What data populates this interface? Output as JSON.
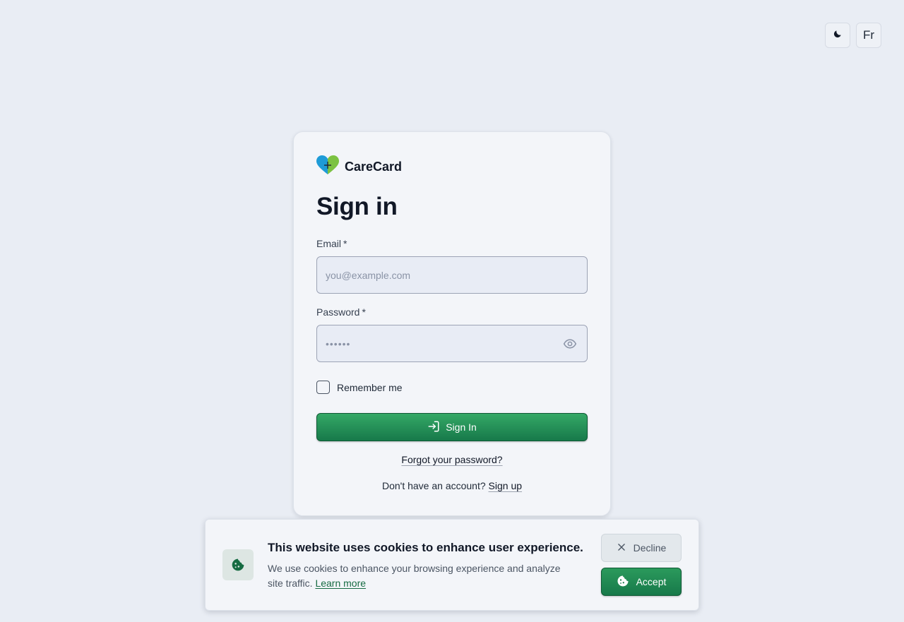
{
  "top_controls": {
    "theme_icon": "moon-icon",
    "language_label": "Fr"
  },
  "brand": {
    "name": "CareCard",
    "logo_icon": "heart-plus-icon",
    "logo_colors": [
      "#1e9bd7",
      "#7cc242"
    ]
  },
  "form": {
    "title": "Sign in",
    "email_label": "Email",
    "email_required_mark": "*",
    "email_placeholder": "you@example.com",
    "password_label": "Password",
    "password_required_mark": "*",
    "password_mask": "••••••",
    "password_toggle_icon": "eye-icon",
    "remember_label": "Remember me",
    "submit_label": "Sign In",
    "submit_icon": "sign-in-icon",
    "forgot_link": "Forgot your password?",
    "signup_prompt": "Don't have an account?",
    "signup_link": "Sign up"
  },
  "cookie_banner": {
    "icon": "cookie-icon",
    "title": "This website uses cookies to enhance user experience.",
    "text": "We use cookies to enhance your browsing experience and analyze site traffic.",
    "learn_more": "Learn more",
    "decline_label": "Decline",
    "decline_icon": "close-icon",
    "accept_label": "Accept",
    "accept_icon": "cookie-icon"
  },
  "colors": {
    "page_bg": "#e9edf4",
    "card_bg": "#f3f5f9",
    "primary_green": "#17794a",
    "link_green": "#166b42"
  }
}
